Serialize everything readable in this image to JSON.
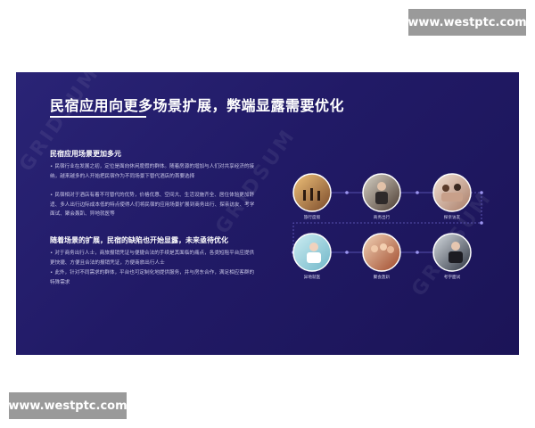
{
  "watermarks": {
    "top": "www.westptc.com",
    "bottom": "www.westptc.com"
  },
  "slide": {
    "title": "民宿应用向更多场景扩展，弊端显露需要优化",
    "background_watermark": "GRIDSUM",
    "section1": {
      "title": "民宿应用场景更加多元",
      "bullets": [
        "民宿行业在发展之初，定位是面向休闲度假的群体。随着房源的增加与人们对共享经济的接纳，越来越多的人开始把民宿作为不同场景下替代酒店的首要选择",
        "民宿相对于酒店有着不可替代的优势，价格优惠、空间大、生活设施齐全、居住体验更加舒适、多人出行边际成本低的特点使得人们将民宿的应用场景扩展到商务出行、探亲访友、考学面试、聚会轰趴、异地就医等"
      ]
    },
    "section2": {
      "title": "随着场景的扩展，民宿的缺陷也开始显露，未来亟待优化",
      "bullets": [
        "对于商务出行人士，商旅报销凭证与便捷合法的手续是其面临的痛点，各类短租平台应提供更快捷、方便且合法的报销凭证，方便商旅出行人士",
        "此外，针对不同需求的群体，平台也可定制化地提供服务，并与房东合作，满足相应客群的特殊需求"
      ]
    },
    "scenes": [
      {
        "label": "旅行度假",
        "icon": "travel-photo-icon"
      },
      {
        "label": "商务出行",
        "icon": "business-photo-icon"
      },
      {
        "label": "探亲访友",
        "icon": "family-photo-icon"
      },
      {
        "label": "异地就医",
        "icon": "medical-photo-icon"
      },
      {
        "label": "聚会轰趴",
        "icon": "party-photo-icon"
      },
      {
        "label": "考学面试",
        "icon": "interview-photo-icon"
      }
    ]
  },
  "colors": {
    "slide_background": "#221b69",
    "connector": "#6a63c8",
    "text_white": "#ffffff"
  }
}
